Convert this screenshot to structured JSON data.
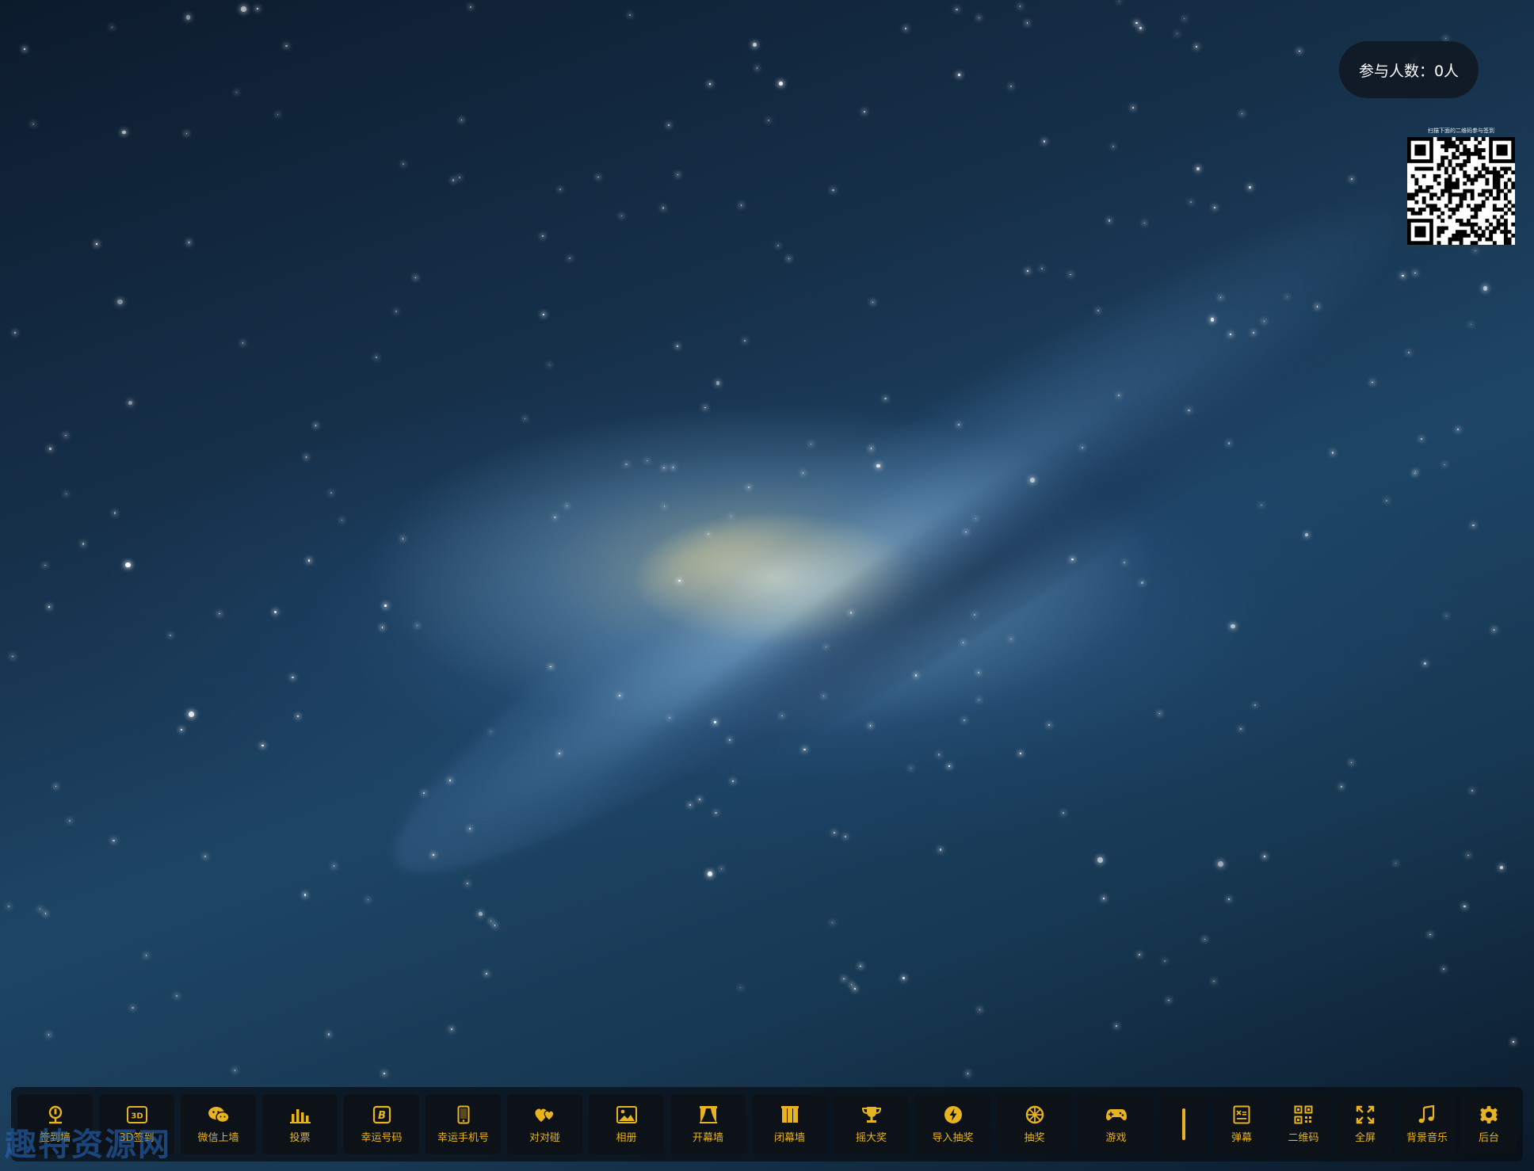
{
  "header": {
    "participant_count": "参与人数：0人"
  },
  "qr": {
    "caption": "扫描下面的二维码参与签到"
  },
  "toolbar": {
    "accent_color": "#e7b321",
    "buttons": [
      {
        "label": "签到墙",
        "icon": "pin-icon"
      },
      {
        "label": "3D签到",
        "icon": "3d-icon"
      },
      {
        "label": "微信上墙",
        "icon": "wechat-icon"
      },
      {
        "label": "投票",
        "icon": "bar-chart-icon"
      },
      {
        "label": "幸运号码",
        "icon": "ticket-icon"
      },
      {
        "label": "幸运手机号",
        "icon": "phone-icon"
      },
      {
        "label": "对对碰",
        "icon": "hearts-icon"
      },
      {
        "label": "相册",
        "icon": "image-icon"
      },
      {
        "label": "开幕墙",
        "icon": "curtain-open-icon"
      },
      {
        "label": "闭幕墙",
        "icon": "curtain-closed-icon"
      },
      {
        "label": "摇大奖",
        "icon": "trophy-icon"
      },
      {
        "label": "导入抽奖",
        "icon": "lightning-icon"
      },
      {
        "label": "抽奖",
        "icon": "wheel-icon"
      },
      {
        "label": "游戏",
        "icon": "gamepad-icon"
      },
      {
        "label": "弹幕",
        "icon": "subtitle-icon"
      },
      {
        "label": "二维码",
        "icon": "qr-icon"
      },
      {
        "label": "全屏",
        "icon": "fullscreen-icon"
      },
      {
        "label": "背景音乐",
        "icon": "music-icon"
      },
      {
        "label": "后台",
        "icon": "gear-icon"
      }
    ]
  },
  "watermark": {
    "text": "趣特资源网"
  }
}
